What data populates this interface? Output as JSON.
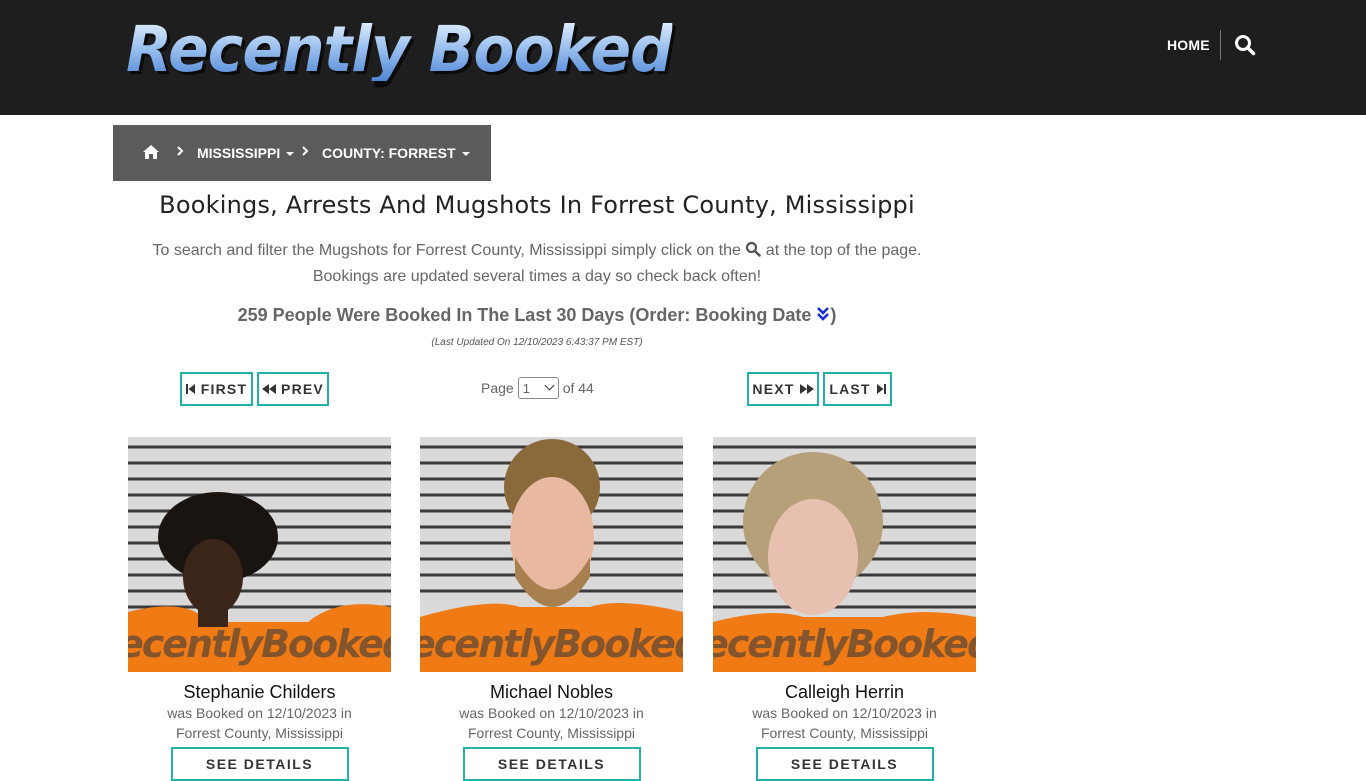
{
  "header": {
    "logo_text": "Recently Booked",
    "nav_home": "HOME",
    "search_icon": "search-icon"
  },
  "breadcrumb": {
    "home_icon": "home-icon",
    "state": "MISSISSIPPI",
    "county": "COUNTY: FORREST"
  },
  "main": {
    "title": "Bookings, Arrests And Mugshots In Forrest County, Mississippi",
    "intro_before": "To search and filter the Mugshots for Forrest County, Mississippi simply click on the",
    "intro_after": "at the top of the page.",
    "intro_line2": "Bookings are updated several times a day so check back often!",
    "count_text": "259 People Were Booked In The Last 30 Days (Order: Booking Date",
    "count_close": ")",
    "last_updated": "(Last Updated On 12/10/2023 6:43:37 PM EST)"
  },
  "pagination": {
    "first": "FIRST",
    "prev": "PREV",
    "next": "NEXT",
    "last": "LAST",
    "page_label": "Page",
    "current_page": "1",
    "of_label": "of 44"
  },
  "cards": [
    {
      "name": "Stephanie Childers",
      "booked_line1": "was Booked on 12/10/2023 in",
      "booked_line2": "Forrest County, Mississippi",
      "watermark": "ecentlyBooked.co",
      "button": "SEE DETAILS"
    },
    {
      "name": "Michael Nobles",
      "booked_line1": "was Booked on 12/10/2023 in",
      "booked_line2": "Forrest County, Mississippi",
      "watermark": "ecentlyBooked.co",
      "button": "SEE DETAILS"
    },
    {
      "name": "Calleigh Herrin",
      "booked_line1": "was Booked on 12/10/2023 in",
      "booked_line2": "Forrest County, Mississippi",
      "watermark": "ecentlyBooked.co",
      "button": "SEE DETAILS"
    }
  ],
  "colors": {
    "header_bg": "#1e1e1e",
    "breadcrumb_bg": "#5b5b5b",
    "accent_teal": "#20b2aa",
    "orange_uniform": "#f07a14",
    "order_icon_blue": "#1a2fd6"
  }
}
